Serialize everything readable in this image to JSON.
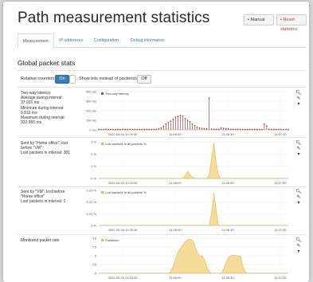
{
  "header": {
    "title": "Path measurement statistics",
    "manual_label": "Manual",
    "reset_label": "Reset statistics"
  },
  "tabs": [
    {
      "label": "Measurement"
    },
    {
      "label": "IP addresses"
    },
    {
      "label": "Configuration"
    },
    {
      "label": "Debug information"
    }
  ],
  "section_title": "Global packet stats",
  "controls": {
    "relative_label": "Relative counters",
    "relative_value": "On",
    "show_label": "Show bits instead of packets/s",
    "show_value": "Off"
  },
  "panels": [
    {
      "side_text": "Two-way latency:\nAverage during interval:\n37.931 ms\nMinimum during interval:\n0.816 ms\nMaximum during interval:\n332.955 ms",
      "chart_data": {
        "type": "bar",
        "legend": "Two-way latency",
        "yticks": [
          "400 ms",
          "300 ms",
          "200 ms",
          "100 ms",
          "0 ms"
        ],
        "ylim": [
          0,
          400
        ],
        "xticks": [
          "2022-04-04 11:05:30",
          "11:06:00",
          "11:06:30",
          "11:07:00"
        ],
        "values": [
          3,
          4,
          3,
          5,
          3,
          4,
          3,
          3,
          4,
          3,
          5,
          3,
          4,
          6,
          3,
          4,
          3,
          3,
          4,
          3,
          5,
          4,
          3,
          4,
          5,
          12,
          20,
          35,
          60,
          75,
          90,
          110,
          130,
          140,
          150,
          145,
          120,
          100,
          85,
          60,
          45,
          30,
          20,
          15,
          12,
          10,
          332,
          8,
          6,
          5,
          5,
          20,
          15,
          10,
          8,
          6,
          5,
          4,
          5,
          4,
          4,
          3,
          4,
          5,
          3,
          4,
          3,
          4,
          3,
          60,
          40,
          5,
          4,
          3,
          4,
          5,
          4,
          3,
          4,
          3
        ]
      }
    },
    {
      "side_text": "Sent by \"Home office\", lost\nbefore \"VM\"\nLost packets in interval: 381",
      "chart_data": {
        "type": "area",
        "legend": "Lost packets to all packets %",
        "yticks": [
          "3 %",
          "2 %",
          "1 %",
          "0 %"
        ],
        "ylim": [
          0,
          3
        ],
        "xticks": [
          "2022-04-04 11:05:30",
          "11:06:00",
          "11:06:30",
          "11:07:00"
        ],
        "values": [
          0,
          0,
          0,
          0,
          0,
          0,
          0,
          0,
          0,
          0,
          0,
          0,
          0,
          0,
          0,
          0,
          0,
          0,
          0,
          0,
          0,
          0,
          0,
          0,
          0,
          0,
          0,
          0,
          0,
          0,
          0,
          0,
          0,
          0,
          0,
          0,
          0.2,
          0.6,
          0.3,
          0.1,
          0,
          0,
          0,
          0,
          0,
          0,
          0.3,
          1.6,
          2.9,
          1.2,
          0.2,
          0,
          0,
          0,
          0,
          0,
          0,
          0,
          0,
          0,
          0,
          0,
          0,
          0,
          0,
          0,
          0,
          0,
          0,
          0,
          0,
          0,
          0,
          0,
          0,
          0,
          0,
          0,
          0,
          0
        ]
      }
    },
    {
      "side_text": "Sent by \"VM\", lost before\n\"Home office\"\nLost packets in interval: 2",
      "chart_data": {
        "type": "area",
        "legend": "Lost packets to all packets %",
        "yticks": [
          "0.01 %",
          "0.01 %",
          "0.01 %",
          "0 %"
        ],
        "ylim": [
          0,
          0.01
        ],
        "xticks": [
          "2022-04-04 11:05:30",
          "11:06:00",
          "11:06:30",
          "11:07:00"
        ],
        "values": [
          0,
          0,
          0,
          0,
          0,
          0,
          0,
          0,
          0,
          0,
          0,
          0,
          0,
          0,
          0,
          0,
          0,
          0,
          0,
          0,
          0,
          0,
          0,
          0,
          0,
          0,
          0,
          0,
          0,
          0,
          0,
          0,
          0,
          0,
          0,
          0,
          0,
          0,
          0,
          0,
          0,
          0,
          0,
          0,
          0,
          0,
          0,
          0.0035,
          0.0092,
          0.004,
          0,
          0,
          0,
          0,
          0,
          0,
          0,
          0,
          0,
          0,
          0,
          0,
          0,
          0,
          0,
          0,
          0,
          0,
          0,
          0,
          0,
          0,
          0,
          0,
          0,
          0,
          0,
          0,
          0,
          0
        ]
      }
    },
    {
      "side_text": "Monitored packet rate",
      "chart_data": {
        "type": "area",
        "legend": "Packets/s",
        "yticks": [
          "10",
          "7.5",
          "5",
          "2.5",
          "0"
        ],
        "ylim": [
          0,
          10
        ],
        "xticks": [
          "2022-04-04 11:05:30",
          "11:06:00",
          "11:06:30",
          "11:07:00"
        ],
        "values": [
          0,
          0,
          0,
          0,
          0,
          0,
          0,
          0,
          0,
          0,
          0,
          0,
          0,
          0,
          0,
          0,
          0,
          0,
          0,
          0,
          0,
          0,
          0,
          0,
          0,
          0,
          0,
          0,
          0,
          0,
          0.5,
          2,
          4,
          6,
          7,
          8,
          9,
          9.5,
          9.7,
          9.4,
          8,
          6,
          5,
          5,
          4,
          2,
          0.5,
          0,
          0,
          0,
          0,
          0,
          1,
          3,
          4.5,
          5,
          5.2,
          5.1,
          5,
          4.9,
          2,
          0.5,
          0,
          0,
          0,
          0,
          0,
          0,
          0,
          0,
          0,
          0,
          0,
          0,
          0,
          0,
          0,
          0,
          0,
          0
        ]
      }
    }
  ],
  "colors": {
    "latency": "#a94442",
    "area_fill": "#f5dc98",
    "area_stroke": "#e0b64a",
    "accent": "#337ab7"
  }
}
